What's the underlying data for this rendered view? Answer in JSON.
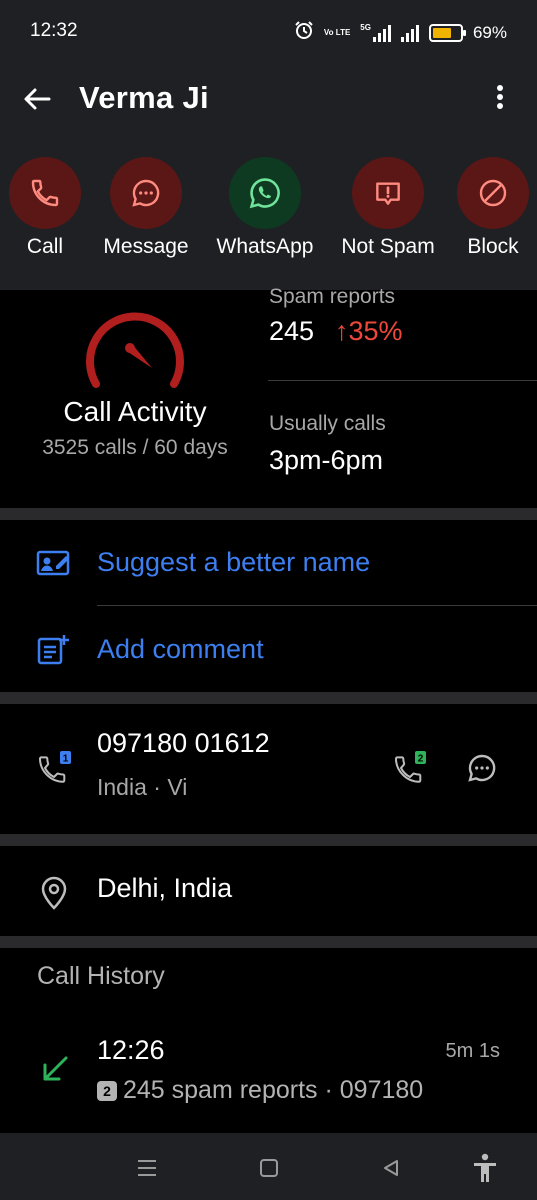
{
  "status_bar": {
    "time": "12:32",
    "volte_label": "Vo LTE",
    "network_label": "5G",
    "battery_percent": "69%",
    "battery_level": 0.69
  },
  "header": {
    "title": "Verma Ji"
  },
  "actions": [
    {
      "label": "Call",
      "icon": "phone-icon"
    },
    {
      "label": "Message",
      "icon": "message-icon"
    },
    {
      "label": "WhatsApp",
      "icon": "whatsapp-icon"
    },
    {
      "label": "Not Spam",
      "icon": "not-spam-icon"
    },
    {
      "label": "Block",
      "icon": "block-icon"
    }
  ],
  "stats": {
    "activity_title": "Call Activity",
    "activity_sub": "3525 calls / 60 days",
    "spam_label": "Spam reports",
    "spam_count": "245",
    "spam_change": "↑35%",
    "calls_label": "Usually calls",
    "calls_value": "3pm-6pm"
  },
  "suggestions": {
    "suggest_name": "Suggest a better name",
    "add_comment": "Add comment"
  },
  "number": {
    "value": "097180 01612",
    "sub": "India · Vi",
    "sim1": "1",
    "sim2": "2"
  },
  "location": {
    "value": "Delhi, India"
  },
  "history": {
    "title": "Call History",
    "entries": [
      {
        "time": "12:26",
        "duration": "5m 1s",
        "sim": "2",
        "detail": "245 spam reports · 097180"
      }
    ]
  },
  "colors": {
    "accent_blue": "#3d7ff0",
    "spam_red": "#f0473b",
    "action_red_bg": "#5a1716",
    "action_green_bg": "#0f3a22",
    "header_bg": "#1f2023"
  }
}
